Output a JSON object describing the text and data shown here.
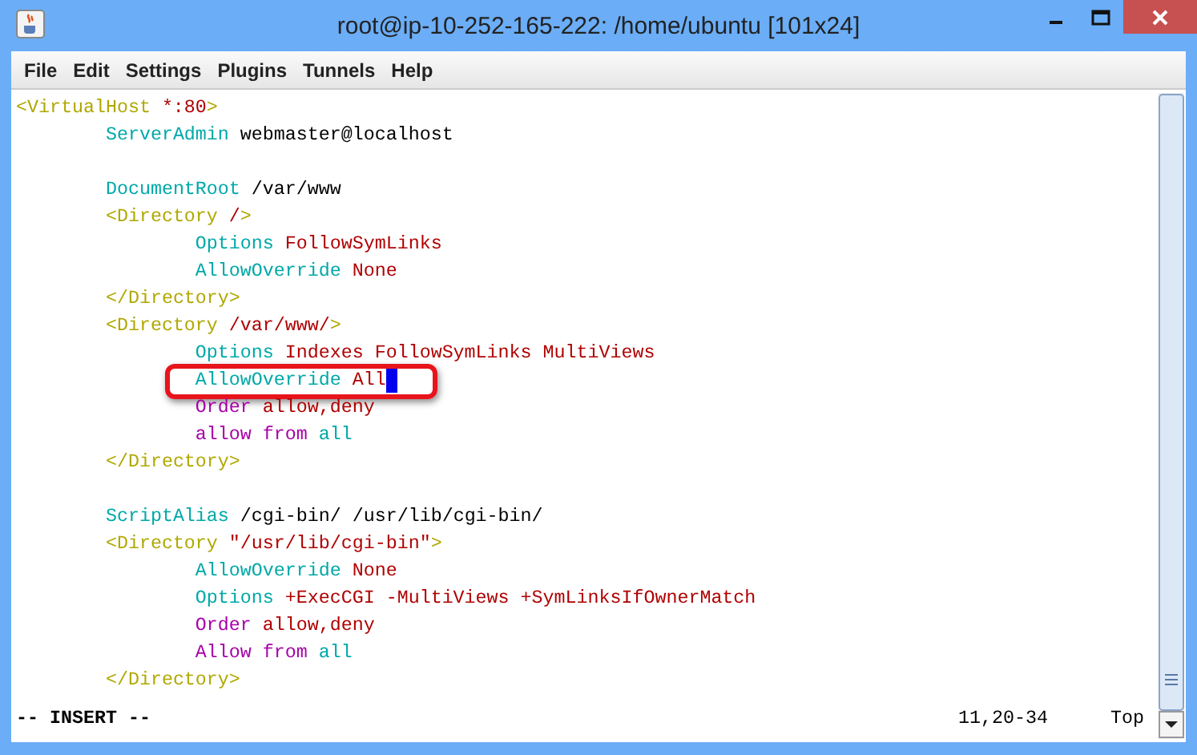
{
  "window": {
    "title": "root@ip-10-252-165-222: /home/ubuntu [101x24]"
  },
  "menu": [
    "File",
    "Edit",
    "Settings",
    "Plugins",
    "Tunnels",
    "Help"
  ],
  "lines": [
    {
      "tokens": [
        {
          "text": "<VirtualHost ",
          "kind": "tag"
        },
        {
          "text": "*:80",
          "kind": "value"
        },
        {
          "text": ">",
          "kind": "tag"
        }
      ]
    },
    {
      "tokens": [
        {
          "text": "\tServerAdmin",
          "kind": "directive"
        },
        {
          "text": " webmaster@localhost",
          "kind": "plain"
        }
      ]
    },
    {
      "kind": "blank"
    },
    {
      "tokens": [
        {
          "text": "\tDocumentRoot",
          "kind": "directive"
        },
        {
          "text": " /var/www",
          "kind": "plain"
        }
      ]
    },
    {
      "tokens": [
        {
          "text": "\t<Directory ",
          "kind": "tag"
        },
        {
          "text": "/",
          "kind": "value"
        },
        {
          "text": ">",
          "kind": "tag"
        }
      ]
    },
    {
      "tokens": [
        {
          "text": "\t\tOptions",
          "kind": "directive"
        },
        {
          "text": " FollowSymLinks",
          "kind": "value"
        }
      ]
    },
    {
      "tokens": [
        {
          "text": "\t\tAllowOverride",
          "kind": "directive"
        },
        {
          "text": " None",
          "kind": "value"
        }
      ]
    },
    {
      "tokens": [
        {
          "text": "\t</Directory>",
          "kind": "tag"
        }
      ]
    },
    {
      "tokens": [
        {
          "text": "\t<Directory ",
          "kind": "tag"
        },
        {
          "text": "/var/www/",
          "kind": "value"
        },
        {
          "text": ">",
          "kind": "tag"
        }
      ]
    },
    {
      "tokens": [
        {
          "text": "\t\tOptions",
          "kind": "directive"
        },
        {
          "text": " Indexes FollowSymLinks MultiViews",
          "kind": "value"
        }
      ]
    },
    {
      "tokens": [
        {
          "text": "\t\tAllowOverride",
          "kind": "directive"
        },
        {
          "text": " All",
          "kind": "value"
        }
      ],
      "cursor": true,
      "highlighted": true
    },
    {
      "tokens": [
        {
          "text": "\t\tOrder",
          "kind": "access"
        },
        {
          "text": " allow,deny",
          "kind": "value"
        }
      ]
    },
    {
      "tokens": [
        {
          "text": "\t\tallow from",
          "kind": "access"
        },
        {
          "text": " all",
          "kind": "directive"
        }
      ]
    },
    {
      "tokens": [
        {
          "text": "\t</Directory>",
          "kind": "tag"
        }
      ]
    },
    {
      "kind": "blank"
    },
    {
      "tokens": [
        {
          "text": "\tScriptAlias",
          "kind": "directive"
        },
        {
          "text": " /cgi-bin/ /usr/lib/cgi-bin/",
          "kind": "plain"
        }
      ]
    },
    {
      "tokens": [
        {
          "text": "\t<Directory ",
          "kind": "tag"
        },
        {
          "text": "\"/usr/lib/cgi-bin\"",
          "kind": "value"
        },
        {
          "text": ">",
          "kind": "tag"
        }
      ]
    },
    {
      "tokens": [
        {
          "text": "\t\tAllowOverride",
          "kind": "directive"
        },
        {
          "text": " None",
          "kind": "value"
        }
      ]
    },
    {
      "tokens": [
        {
          "text": "\t\tOptions",
          "kind": "directive"
        },
        {
          "text": " +ExecCGI -MultiViews +SymLinksIfOwnerMatch",
          "kind": "value"
        }
      ]
    },
    {
      "tokens": [
        {
          "text": "\t\tOrder",
          "kind": "access"
        },
        {
          "text": " allow,deny",
          "kind": "value"
        }
      ]
    },
    {
      "tokens": [
        {
          "text": "\t\tAllow from",
          "kind": "access"
        },
        {
          "text": " all",
          "kind": "directive"
        }
      ]
    },
    {
      "tokens": [
        {
          "text": "\t</Directory>",
          "kind": "tag"
        }
      ]
    }
  ],
  "status": {
    "mode": "-- INSERT --",
    "position": "11,20-34",
    "scroll": "Top"
  }
}
